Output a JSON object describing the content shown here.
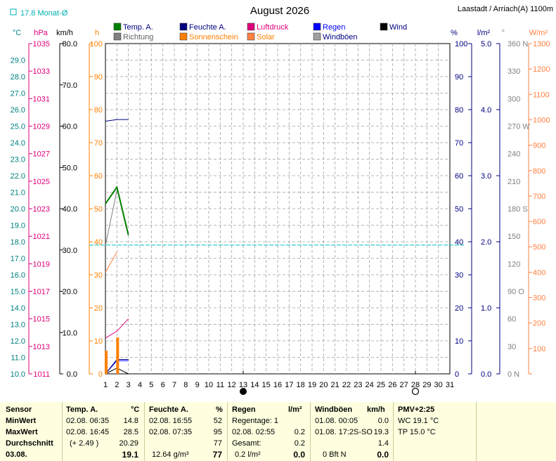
{
  "header": {
    "title": "August 2026",
    "station": "Laastadt / Arriach(A) 1100m",
    "monthly_avg": "17.8 Monat-Ø"
  },
  "legend": [
    {
      "label": "Temp. A.",
      "color": "#008000"
    },
    {
      "label": "Feuchte A.",
      "color": "#000080"
    },
    {
      "label": "Luftdruck",
      "color": "#e0007a"
    },
    {
      "label": "Regen",
      "color": "#0000ff"
    },
    {
      "label": "Wind",
      "color": "#000000"
    },
    {
      "label": "Richtung",
      "color": "#808080"
    },
    {
      "label": "Sonnenschein",
      "color": "#ff8000"
    },
    {
      "label": "Solar",
      "color": "#ff8040"
    },
    {
      "label": "Windböen",
      "color": "#a0a0a0"
    }
  ],
  "axes": {
    "temp": {
      "unit": "°C",
      "color": "#008080",
      "ticks": [
        "29.0",
        "28.0",
        "27.0",
        "26.0",
        "25.0",
        "24.0",
        "23.0",
        "22.0",
        "21.0",
        "20.0",
        "19.0",
        "18.0",
        "17.0",
        "16.0",
        "15.0",
        "14.0",
        "13.0",
        "12.0",
        "11.0",
        "10.0"
      ]
    },
    "pressure": {
      "unit": "hPa",
      "color": "#e0007a",
      "ticks": [
        "1035",
        "1033",
        "1031",
        "1029",
        "1027",
        "1025",
        "1023",
        "1021",
        "1019",
        "1017",
        "1015",
        "1013",
        "1011"
      ]
    },
    "wind": {
      "unit": "km/h",
      "color": "#000000",
      "ticks": [
        "80.0",
        "70.0",
        "60.0",
        "50.0",
        "40.0",
        "30.0",
        "20.0",
        "10.0",
        "0.0"
      ]
    },
    "sun_hours": {
      "unit": "h",
      "color": "#ff8000",
      "ticks": [
        "100",
        "90",
        "80",
        "70",
        "60",
        "50",
        "40",
        "30",
        "20",
        "10",
        "0"
      ]
    },
    "humidity": {
      "unit": "%",
      "color": "#000080",
      "ticks": [
        "100",
        "90",
        "80",
        "70",
        "60",
        "50",
        "40",
        "30",
        "20",
        "10",
        "0"
      ]
    },
    "rain": {
      "unit": "l/m²",
      "color": "#0000a0",
      "ticks": [
        "5.0",
        "4.0",
        "3.0",
        "2.0",
        "1.0",
        "0.0"
      ]
    },
    "direction": {
      "unit": "°",
      "color": "#808080",
      "ticks": [
        "360 N",
        "330",
        "300",
        "270 W",
        "240",
        "210",
        "180 S",
        "150",
        "120",
        "90 O",
        "60",
        "30",
        "0 N"
      ]
    },
    "solar": {
      "unit": "W/m²",
      "color": "#ff8040",
      "ticks": [
        "1300",
        "1200",
        "1100",
        "1000",
        "900",
        "800",
        "700",
        "600",
        "500",
        "400",
        "300",
        "200",
        "100",
        "0"
      ]
    },
    "days": [
      "1",
      "2",
      "3",
      "4",
      "5",
      "6",
      "7",
      "8",
      "9",
      "10",
      "11",
      "12",
      "13",
      "14",
      "15",
      "16",
      "17",
      "18",
      "19",
      "20",
      "21",
      "22",
      "23",
      "24",
      "25",
      "26",
      "27",
      "28",
      "29",
      "30",
      "31"
    ]
  },
  "chart_data": {
    "type": "line",
    "title": "August 2026",
    "x": [
      1,
      2,
      3
    ],
    "xlim": [
      1,
      31
    ],
    "series": [
      {
        "name": "Temp. A.",
        "unit": "°C",
        "values": [
          20.3,
          21.3,
          18.4
        ],
        "ylim": [
          10,
          30
        ]
      },
      {
        "name": "Feuchte A.",
        "unit": "%",
        "values": [
          76.5,
          77.0,
          77.0
        ],
        "ylim": [
          0,
          100
        ]
      },
      {
        "name": "Luftdruck",
        "unit": "hPa",
        "values": [
          1013.6,
          1014.1,
          1015.0
        ],
        "ylim": [
          1011,
          1035
        ]
      },
      {
        "name": "Regen",
        "unit": "l/m²",
        "values": [
          0.0,
          0.2,
          0.2
        ],
        "ylim": [
          0,
          5
        ]
      },
      {
        "name": "Wind",
        "unit": "km/h",
        "values": [
          0.0,
          1.4,
          0.0
        ],
        "ylim": [
          0,
          80
        ]
      },
      {
        "name": "Richtung",
        "unit": "°",
        "values": [
          140,
          200
        ],
        "ylim": [
          0,
          360
        ]
      },
      {
        "name": "Solar",
        "unit": "W/m²",
        "values": [
          400,
          480
        ],
        "ylim": [
          0,
          1300
        ]
      },
      {
        "name": "Windböen",
        "unit": "km/h",
        "values": [
          0.0,
          3.5,
          3.5
        ],
        "ylim": [
          0,
          80
        ]
      },
      {
        "name": "Sonnenschein",
        "unit": "h",
        "bars": [
          7,
          11
        ],
        "ylim": [
          0,
          100
        ]
      }
    ],
    "reference_line": {
      "name": "Monat-Ø",
      "unit": "°C",
      "value": 17.8
    },
    "moon_phases": [
      {
        "day": 13,
        "phase": "new"
      },
      {
        "day": 28,
        "phase": "full"
      }
    ]
  },
  "stats": {
    "sensor": {
      "header": "Sensor",
      "min": "MinWert",
      "max": "MaxWert",
      "avg": "Durchschnitt",
      "date": "03.08."
    },
    "temp": {
      "header": "Temp. A.",
      "unit": "°C",
      "min_time": "02.08.  06:35",
      "min_val": "14.8",
      "max_time": "02.08.  16:45",
      "max_val": "28.5",
      "avg_diff": "(+ 2.49 )",
      "avg_val": "20.29",
      "current": "19.1"
    },
    "humidity": {
      "header": "Feuchte A.",
      "unit": "%",
      "min_time": "02.08.  16:55",
      "min_val": "52",
      "max_time": "02.08.  07:35",
      "max_val": "95",
      "avg_val": "77",
      "abs": "12.64 g/m³",
      "current": "77"
    },
    "rain": {
      "header": "Regen",
      "unit": "l/m²",
      "days": "Regentage: 1",
      "max_time": "02.08.  02:55",
      "max_val": "0.2",
      "total_label": "Gesamt:",
      "total_val": "0.2",
      "current_rate": "0.2 l/m²",
      "current": "0.0"
    },
    "gusts": {
      "header": "Windböen",
      "unit": "km/h",
      "min_time": "01.08.  00:05",
      "min_val": "0.0",
      "max_time": "01.08.  17:2S-SO",
      "max_val": "19.3",
      "avg_val": "1.4",
      "bft": "0 Bft N",
      "current": "0.0"
    },
    "pmv": {
      "header": "PMV+2:25",
      "wc": "WC 19.1 °C",
      "tp": "TP 15.0 °C"
    }
  }
}
